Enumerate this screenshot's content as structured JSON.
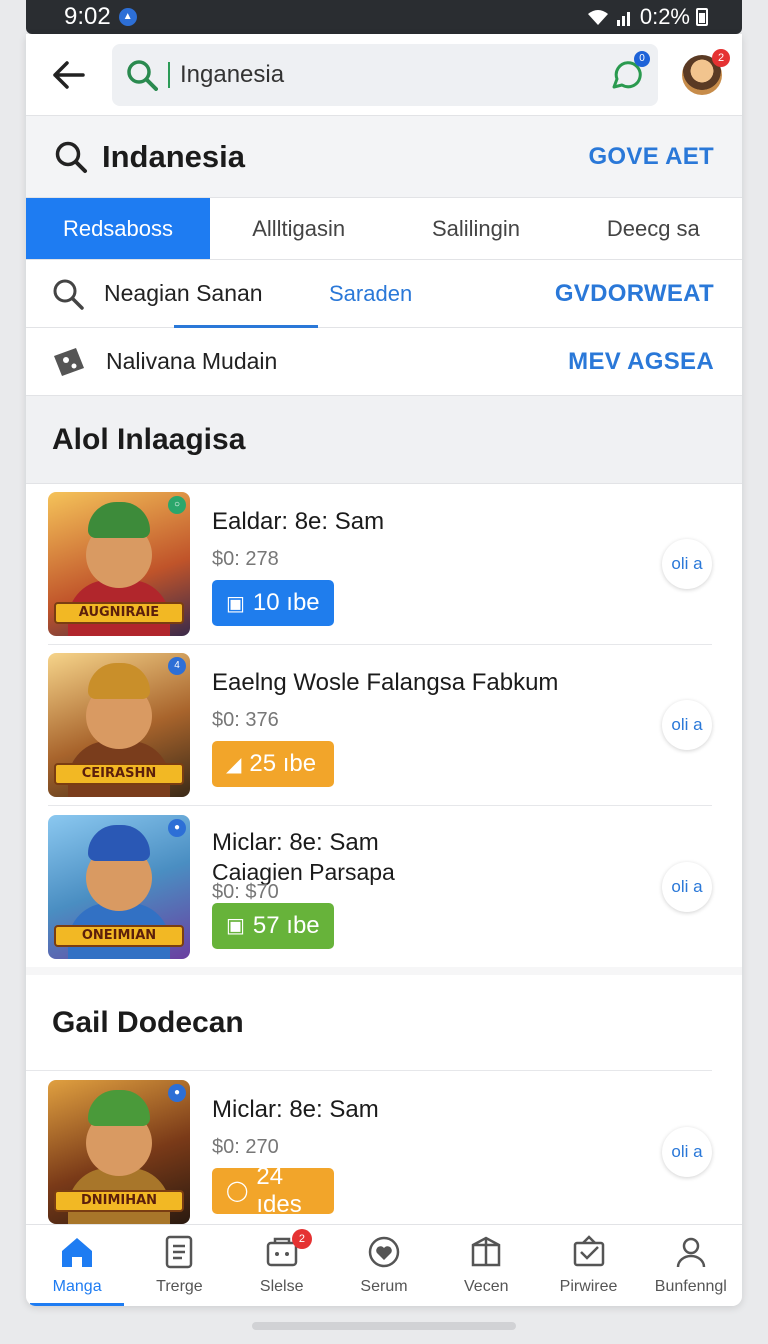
{
  "status": {
    "time": "9:02",
    "battery": "0:2%"
  },
  "search": {
    "value": "Inganesia"
  },
  "header": {
    "title": "Indanesia",
    "action": "GOVE AET"
  },
  "tabs": [
    "Redsaboss",
    "Allltigasin",
    "Salilingin",
    "Deecg sa"
  ],
  "filter_row": {
    "label": "Neagian Sanan",
    "middle": "Saraden",
    "action": "GVDORWEAT"
  },
  "nav_row": {
    "label": "Nalivana Mudain",
    "action": "MEV AGSEA"
  },
  "section1": {
    "title": "Alol Inlaagisa",
    "items": [
      {
        "name": "Ealdar: 8e: Sam",
        "sub": "",
        "price": "$0: 278",
        "button": "10 ıbe",
        "btn_color": "#1f7ded",
        "btn_icon": "bag-icon",
        "thumb_label": "AUGNIRAIE",
        "pill": "oli a"
      },
      {
        "name": "Eaelng Wosle Falangsa Fabkum",
        "sub": "",
        "price": "$0: 376",
        "button": "25 ıbe",
        "btn_color": "#f2a52a",
        "btn_icon": "tag-icon",
        "thumb_label": "CEIRASHN",
        "pill": "oli a"
      },
      {
        "name": "Miclar: 8e: Sam",
        "sub": "Caiagien Parsapa",
        "price": "$0: $70",
        "button": "57 ıbe",
        "btn_color": "#67b33a",
        "btn_icon": "bag-icon",
        "thumb_label": "ONEIMIAN",
        "pill": "oli a"
      }
    ]
  },
  "section2": {
    "title": "Gail Dodecan",
    "items": [
      {
        "name": "Miclar: 8e: Sam",
        "sub": "",
        "price": "$0: 270",
        "button": "24 ıdes",
        "btn_color": "#f2a52a",
        "btn_icon": "clock-icon",
        "thumb_label": "DNIMIHAN",
        "pill": "oli a"
      }
    ]
  },
  "bottom_nav": [
    "Manga",
    "Trerge",
    "Slelse",
    "Serum",
    "Vecen",
    "Pirwiree",
    "Bunfenngl"
  ],
  "badges": {
    "chat": "0",
    "avatar": "2",
    "nav_slelse": "2"
  }
}
